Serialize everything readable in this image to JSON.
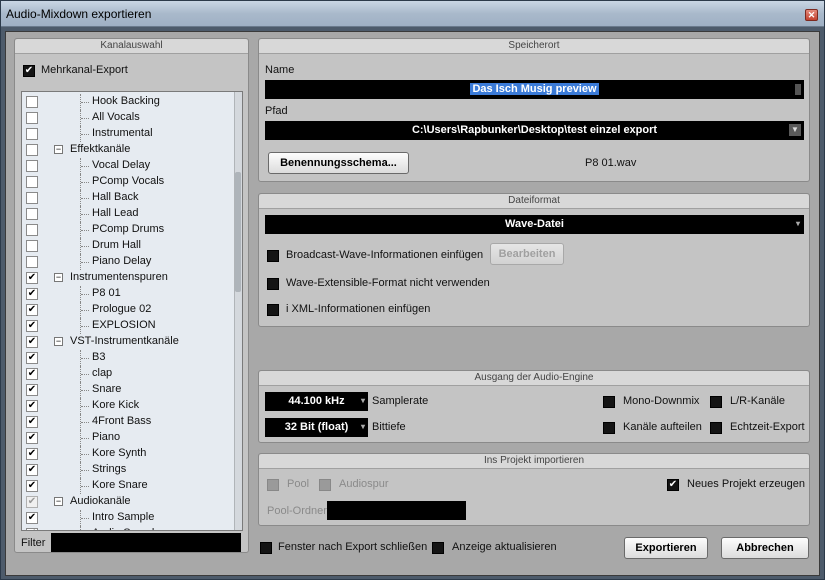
{
  "window": {
    "title": "Audio-Mixdown exportieren"
  },
  "left": {
    "header": "Kanalauswahl",
    "multichannel_label": "Mehrkanal-Export",
    "multichannel_checked": true,
    "filter_label": "Filter",
    "tree": [
      {
        "label": "Hook Backing",
        "level": 2,
        "checked": false
      },
      {
        "label": "All Vocals",
        "level": 2,
        "checked": false
      },
      {
        "label": "Instrumental",
        "level": 2,
        "checked": false
      },
      {
        "label": "Effektkanäle",
        "level": 1,
        "checked": false,
        "group": true
      },
      {
        "label": "Vocal Delay",
        "level": 2,
        "checked": false
      },
      {
        "label": "PComp Vocals",
        "level": 2,
        "checked": false
      },
      {
        "label": "Hall Back",
        "level": 2,
        "checked": false
      },
      {
        "label": "Hall Lead",
        "level": 2,
        "checked": false
      },
      {
        "label": "PComp Drums",
        "level": 2,
        "checked": false
      },
      {
        "label": "Drum Hall",
        "level": 2,
        "checked": false
      },
      {
        "label": "Piano Delay",
        "level": 2,
        "checked": false
      },
      {
        "label": "Instrumentenspuren",
        "level": 1,
        "checked": true,
        "group": true
      },
      {
        "label": "P8 01",
        "level": 2,
        "checked": true
      },
      {
        "label": "Prologue 02",
        "level": 2,
        "checked": true
      },
      {
        "label": "EXPLOSION",
        "level": 2,
        "checked": true
      },
      {
        "label": "VST-Instrumentkanäle",
        "level": 1,
        "checked": true,
        "group": true
      },
      {
        "label": "B3",
        "level": 2,
        "checked": true
      },
      {
        "label": "clap",
        "level": 2,
        "checked": true
      },
      {
        "label": "Snare",
        "level": 2,
        "checked": true
      },
      {
        "label": "Kore Kick",
        "level": 2,
        "checked": true
      },
      {
        "label": "4Front Bass",
        "level": 2,
        "checked": true
      },
      {
        "label": "Piano",
        "level": 2,
        "checked": true
      },
      {
        "label": "Kore Synth",
        "level": 2,
        "checked": true
      },
      {
        "label": "Strings",
        "level": 2,
        "checked": true
      },
      {
        "label": "Kore Snare",
        "level": 2,
        "checked": true
      },
      {
        "label": "Audiokanäle",
        "level": 1,
        "checked": true,
        "group": true,
        "dim": true
      },
      {
        "label": "Intro Sample",
        "level": 2,
        "checked": true
      },
      {
        "label": "Audio Sample",
        "level": 2,
        "checked": true
      }
    ]
  },
  "location": {
    "header": "Speicherort",
    "name_label": "Name",
    "name_value": "Das Isch Musig preview",
    "path_label": "Pfad",
    "path_value": "C:\\Users\\Rapbunker\\Desktop\\test einzel export",
    "naming_button": "Benennungsschema...",
    "naming_preview": "P8 01.wav"
  },
  "format": {
    "header": "Dateiformat",
    "format_value": "Wave-Datei",
    "bwf_label": "Broadcast-Wave-Informationen einfügen",
    "edit_button": "Bearbeiten",
    "wave_ext_label": "Wave-Extensible-Format nicht verwenden",
    "ixml_label": "i XML-Informationen einfügen"
  },
  "engine": {
    "header": "Ausgang der Audio-Engine",
    "samplerate_value": "44.100 kHz",
    "samplerate_label": "Samplerate",
    "bitdepth_value": "32 Bit (float)",
    "bitdepth_label": "Bittiefe",
    "mono_label": "Mono-Downmix",
    "lr_label": "L/R-Kanäle",
    "split_label": "Kanäle aufteilen",
    "realtime_label": "Echtzeit-Export"
  },
  "import": {
    "header": "Ins Projekt importieren",
    "pool_label": "Pool",
    "audiotrack_label": "Audiospur",
    "new_project_label": "Neues Projekt erzeugen",
    "new_project_checked": true,
    "pool_folder_label": "Pool-Ordner"
  },
  "footer": {
    "close_after_label": "Fenster nach Export schließen",
    "refresh_label": "Anzeige aktualisieren",
    "export_button": "Exportieren",
    "cancel_button": "Abbrechen"
  },
  "colors": {
    "accent_selection": "#3b7bd8",
    "field_bg": "#000000",
    "panel_bg": "#c4c4c4"
  }
}
